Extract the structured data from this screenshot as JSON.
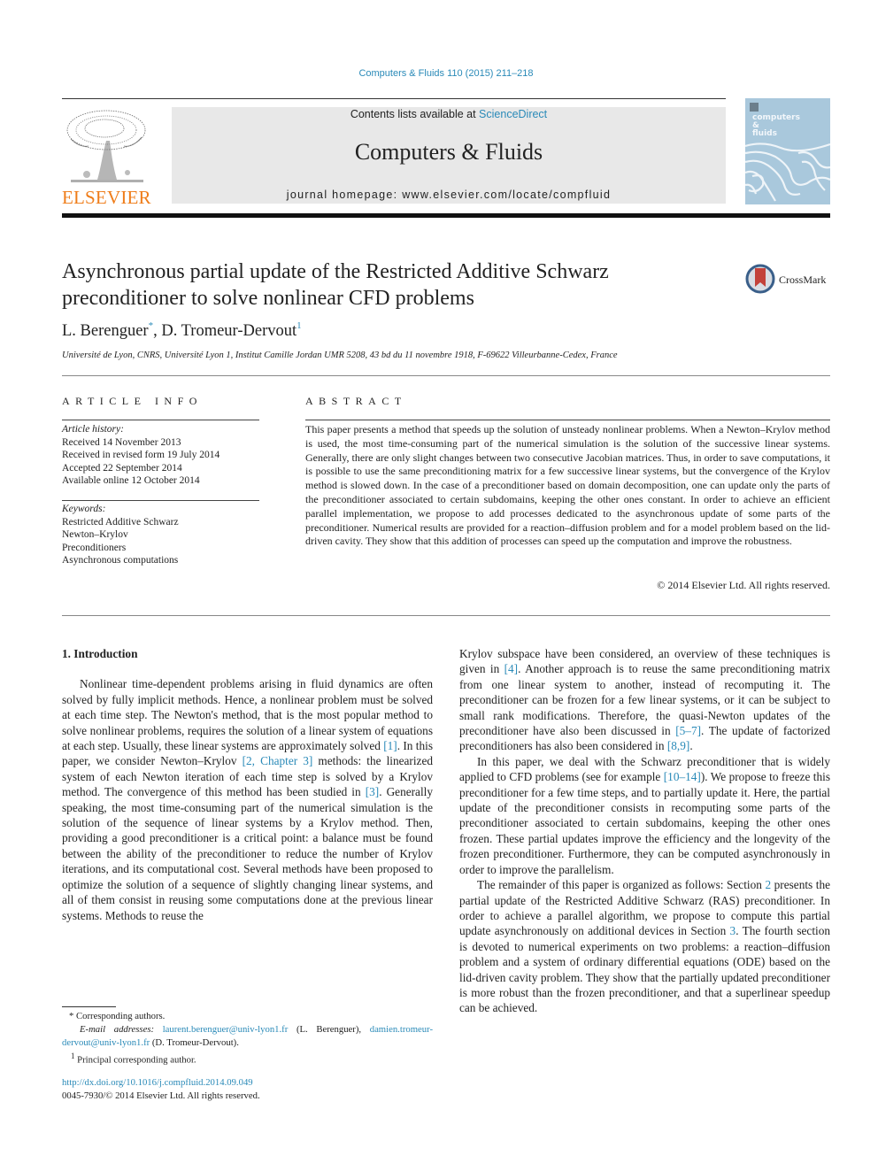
{
  "citation": "Computers & Fluids 110 (2015) 211–218",
  "header": {
    "publisher": "ELSEVIER",
    "contents_prefix": "Contents lists available at ",
    "contents_link": "ScienceDirect",
    "journal_name": "Computers & Fluids",
    "homepage_prefix": "journal homepage: ",
    "homepage_url": "www.elsevier.com/locate/compfluid",
    "cover_title_lines": [
      "computers",
      "&",
      "fluids"
    ]
  },
  "colors": {
    "link": "#2a8ab8",
    "elsevier_orange": "#ef7d1a",
    "header_gray": "#e8e8e8",
    "cover_blue": "#a9c8dc"
  },
  "article": {
    "title": "Asynchronous partial update of the Restricted Additive Schwarz preconditioner to solve nonlinear CFD problems",
    "crossmark_label": "CrossMark",
    "authors": [
      {
        "name": "L. Berenguer",
        "mark": "*"
      },
      {
        "name": "D. Tromeur-Dervout",
        "mark": "1"
      }
    ],
    "affiliation": "Université de Lyon, CNRS, Université Lyon 1, Institut Camille Jordan UMR 5208, 43 bd du 11 novembre 1918, F-69622 Villeurbanne-Cedex, France"
  },
  "article_info": {
    "heading": "ARTICLE INFO",
    "history_label": "Article history:",
    "history": [
      "Received 14 November 2013",
      "Received in revised form 19 July 2014",
      "Accepted 22 September 2014",
      "Available online 12 October 2014"
    ],
    "keywords_label": "Keywords:",
    "keywords": [
      "Restricted Additive Schwarz",
      "Newton–Krylov",
      "Preconditioners",
      "Asynchronous computations"
    ]
  },
  "abstract": {
    "heading": "ABSTRACT",
    "text": "This paper presents a method that speeds up the solution of unsteady nonlinear problems. When a Newton–Krylov method is used, the most time-consuming part of the numerical simulation is the solution of the successive linear systems. Generally, there are only slight changes between two consecutive Jacobian matrices. Thus, in order to save computations, it is possible to use the same preconditioning matrix for a few successive linear systems, but the convergence of the Krylov method is slowed down. In the case of a preconditioner based on domain decomposition, one can update only the parts of the preconditioner associated to certain subdomains, keeping the other ones constant. In order to achieve an efficient parallel implementation, we propose to add processes dedicated to the asynchronous update of some parts of the preconditioner. Numerical results are provided for a reaction–diffusion problem and for a model problem based on the lid-driven cavity. They show that this addition of processes can speed up the computation and improve the robustness.",
    "copyright": "© 2014 Elsevier Ltd. All rights reserved."
  },
  "body": {
    "section_heading": "1. Introduction",
    "left_paragraph": [
      {
        "t": "Nonlinear time-dependent problems arising in fluid dynamics are often solved by fully implicit methods. Hence, a nonlinear problem must be solved at each time step. The Newton's method, that is the most popular method to solve nonlinear problems, requires the solution of a linear system of equations at each step. Usually, these linear systems are approximately solved "
      },
      {
        "ref": "[1]"
      },
      {
        "t": ". In this paper, we consider Newton–Krylov "
      },
      {
        "ref": "[2, Chapter 3]"
      },
      {
        "t": " methods: the linearized system of each Newton iteration of each time step is solved by a Krylov method. The convergence of this method has been studied in "
      },
      {
        "ref": "[3]"
      },
      {
        "t": ". Generally speaking, the most time-consuming part of the numerical simulation is the solution of the sequence of linear systems by a Krylov method. Then, providing a good preconditioner is a critical point: a balance must be found between the ability of the preconditioner to reduce the number of Krylov iterations, and its computational cost. Several methods have been proposed to optimize the solution of a sequence of slightly changing linear systems, and all of them consist in reusing some computations done at the previous linear systems. Methods to reuse the"
      }
    ],
    "right_paragraph_1": [
      {
        "t": "Krylov subspace have been considered, an overview of these techniques is given in "
      },
      {
        "ref": "[4]"
      },
      {
        "t": ". Another approach is to reuse the same preconditioning matrix from one linear system to another, instead of recomputing it. The preconditioner can be frozen for a few linear systems, or it can be subject to small rank modifications. Therefore, the quasi-Newton updates of the preconditioner have also been discussed in "
      },
      {
        "ref": "[5–7]"
      },
      {
        "t": ". The update of factorized preconditioners has also been considered in "
      },
      {
        "ref": "[8,9]"
      },
      {
        "t": "."
      }
    ],
    "right_paragraph_2": [
      {
        "t": "In this paper, we deal with the Schwarz preconditioner that is widely applied to CFD problems (see for example "
      },
      {
        "ref": "[10–14]"
      },
      {
        "t": "). We propose to freeze this preconditioner for a few time steps, and to partially update it. Here, the partial update of the preconditioner consists in recomputing some parts of the preconditioner associated to certain subdomains, keeping the other ones frozen. These partial updates improve the efficiency and the longevity of the frozen preconditioner. Furthermore, they can be computed asynchronously in order to improve the parallelism."
      }
    ],
    "right_paragraph_3": [
      {
        "t": "The remainder of this paper is organized as follows: Section "
      },
      {
        "ref": "2"
      },
      {
        "t": " presents the partial update of the Restricted Additive Schwarz (RAS) preconditioner. In order to achieve a parallel algorithm, we propose to compute this partial update asynchronously on additional devices in Section "
      },
      {
        "ref": "3"
      },
      {
        "t": ". The fourth section is devoted to numerical experiments on two problems: a reaction–diffusion problem and a system of ordinary differential equations (ODE) based on the lid-driven cavity problem. They show that the partially updated preconditioner is more robust than the frozen preconditioner, and that a superlinear speedup can be achieved."
      }
    ]
  },
  "footnotes": {
    "corresponding_mark": "*",
    "corresponding": "Corresponding authors.",
    "email_label": "E-mail addresses:",
    "email_1": "laurent.berenguer@univ-lyon1.fr",
    "email_1_name": "(L. Berenguer),",
    "email_2": "damien.tromeur-dervout@univ-lyon1.fr",
    "email_2_name": "(D. Tromeur-Dervout).",
    "principal_mark": "1",
    "principal": "Principal corresponding author."
  },
  "doi": {
    "url": "http://dx.doi.org/10.1016/j.compfluid.2014.09.049",
    "issn_line": "0045-7930/© 2014 Elsevier Ltd. All rights reserved."
  }
}
